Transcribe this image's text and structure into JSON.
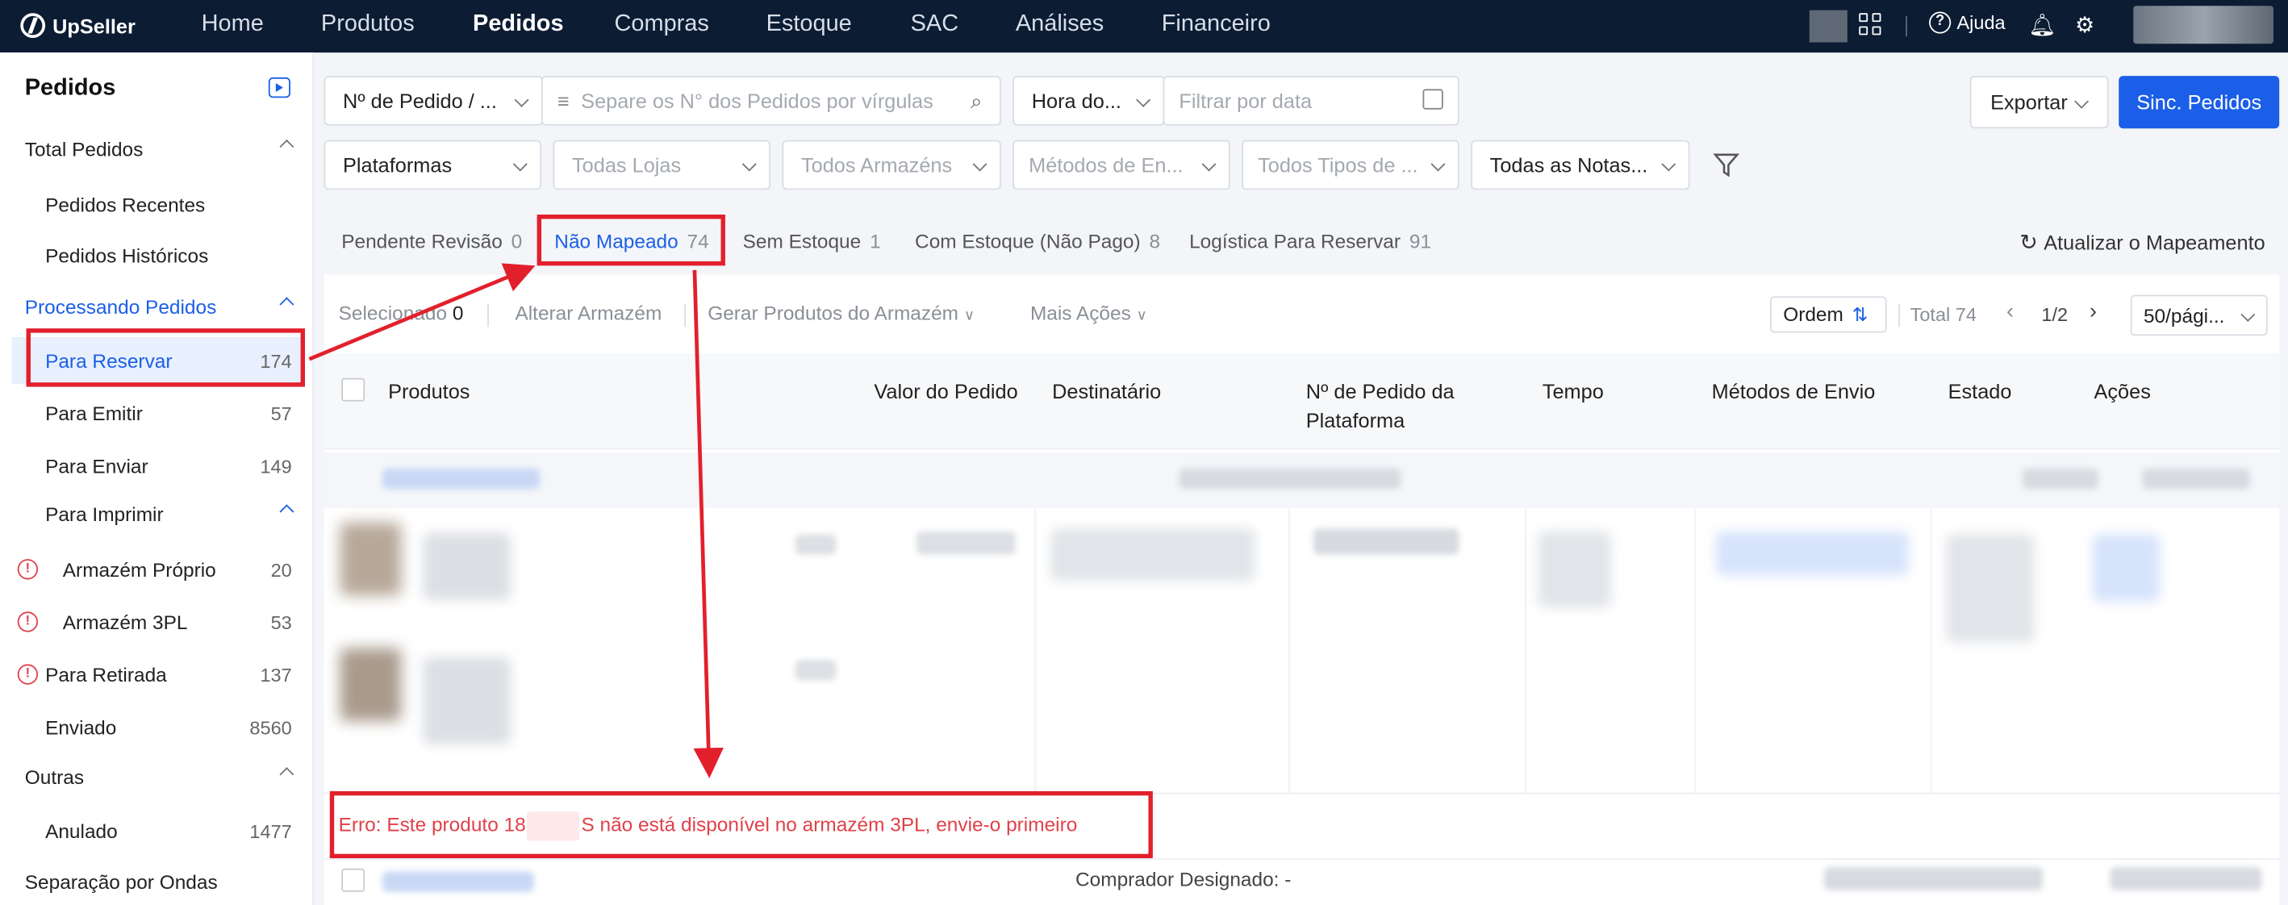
{
  "app": {
    "brand": "UpSeller"
  },
  "nav": {
    "items": [
      "Home",
      "Produtos",
      "Pedidos",
      "Compras",
      "Estoque",
      "SAC",
      "Análises",
      "Financeiro"
    ],
    "active": "Pedidos",
    "help": "Ajuda"
  },
  "sidebar": {
    "title": "Pedidos",
    "sections": [
      {
        "label": "Total Pedidos",
        "items": [
          {
            "label": "Pedidos Recentes"
          },
          {
            "label": "Pedidos Históricos"
          }
        ]
      },
      {
        "label": "Processando Pedidos",
        "items": [
          {
            "label": "Para Reservar",
            "count": "174"
          },
          {
            "label": "Para Emitir",
            "count": "57"
          },
          {
            "label": "Para Enviar",
            "count": "149"
          },
          {
            "label": "Para Imprimir"
          },
          {
            "label": "Armazém Próprio",
            "count": "20"
          },
          {
            "label": "Armazém 3PL",
            "count": "53"
          },
          {
            "label": "Para Retirada",
            "count": "137"
          },
          {
            "label": "Enviado",
            "count": "8560"
          }
        ]
      },
      {
        "label": "Outras",
        "items": [
          {
            "label": "Anulado",
            "count": "1477"
          }
        ]
      },
      {
        "label": "Separação por Ondas"
      }
    ]
  },
  "filters": {
    "search_type": "Nº de Pedido / ...",
    "search_placeholder": "Separe os N° dos Pedidos por vírgulas",
    "time_type": "Hora do...",
    "date_placeholder": "Filtrar por data",
    "export": "Exportar",
    "sync": "Sinc. Pedidos",
    "platforms": "Plataformas",
    "stores": "Todas Lojas",
    "warehouses": "Todos Armazéns",
    "shipping": "Métodos de En...",
    "types": "Todos Tipos de ...",
    "invoices": "Todas as Notas..."
  },
  "tabs": [
    {
      "label": "Pendente Revisão",
      "count": "0"
    },
    {
      "label": "Não Mapeado",
      "count": "74"
    },
    {
      "label": "Sem Estoque",
      "count": "1"
    },
    {
      "label": "Com Estoque (Não Pago)",
      "count": "8"
    },
    {
      "label": "Logística Para Reservar",
      "count": "91"
    }
  ],
  "refresh_mapping": "Atualizar o Mapeamento",
  "toolbar": {
    "selected_label": "Selecionado",
    "selected_count": "0",
    "change_warehouse": "Alterar Armazém",
    "generate_products": "Gerar Produtos do Armazém",
    "more_actions": "Mais Ações",
    "order": "Ordem",
    "total": "Total 74",
    "page": "1/2",
    "page_size": "50/pági..."
  },
  "table": {
    "columns": [
      "Produtos",
      "Valor do Pedido",
      "Destinatário",
      "Nº de Pedido da Plataforma",
      "Tempo",
      "Métodos de Envio",
      "Estado",
      "Ações"
    ]
  },
  "error": {
    "prefix": "Erro: Este produto 18",
    "suffix": "S não está disponível no armazém 3PL, envie-o primeiro"
  },
  "footer": {
    "buyer": "Comprador Designado: -"
  }
}
